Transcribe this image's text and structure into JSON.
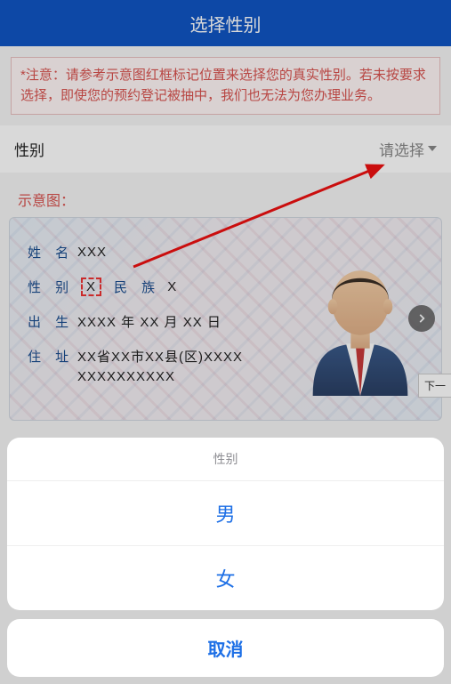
{
  "header": {
    "title": "选择性别"
  },
  "notice": "*注意：请参考示意图红框标记位置来选择您的真实性别。若未按要求选择，即使您的预约登记被抽中，我们也无法为您办理业务。",
  "field": {
    "label": "性别",
    "placeholder": "请选择"
  },
  "diagram": {
    "label": "示意图：",
    "id_card": {
      "name_label": "姓 名",
      "name_value": "XXX",
      "gender_label": "性 别",
      "gender_value": "X",
      "ethnicity_label": "民 族",
      "ethnicity_value": "X",
      "birth_label": "出 生",
      "birth_value": "XXXX 年 XX 月 XX 日",
      "address_label": "住 址",
      "address_line1": "XX省XX市XX县(区)XXXX",
      "address_line2": "XXXXXXXXXX"
    }
  },
  "side_tab": "下一",
  "sheet": {
    "title": "性别",
    "options": [
      "男",
      "女"
    ],
    "cancel": "取消"
  }
}
